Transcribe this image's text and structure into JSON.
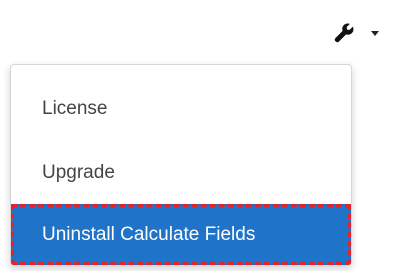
{
  "toolbar": {
    "tools_icon": "wrench-icon",
    "caret_icon": "caret-down-icon"
  },
  "menu": {
    "items": [
      {
        "label": "License"
      },
      {
        "label": "Upgrade"
      },
      {
        "label": "Uninstall Calculate Fields",
        "state": "highlighted"
      }
    ]
  },
  "colors": {
    "highlight_bg": "#1f74c9",
    "highlight_text": "#ffffff",
    "highlight_outline": "#e0242e",
    "item_text": "#444444"
  }
}
